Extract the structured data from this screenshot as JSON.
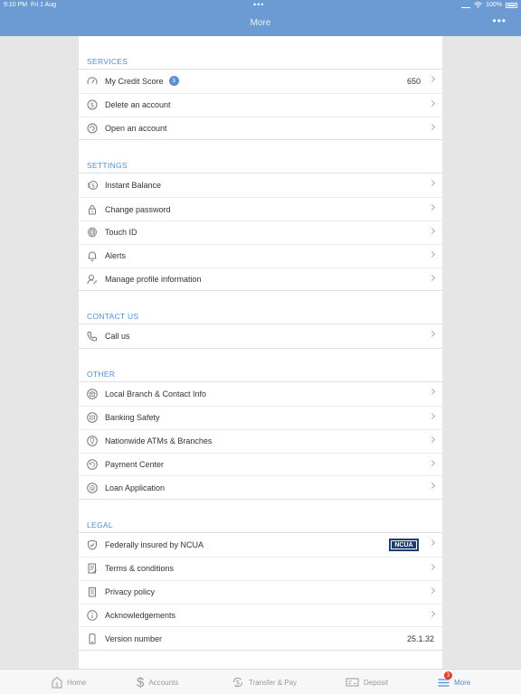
{
  "status_bar": {
    "time": "9:10 PM",
    "date": "Fri 1 Aug",
    "dots": "•••",
    "battery": "100%"
  },
  "nav": {
    "title": "More",
    "menu_icon": "•••"
  },
  "sections": {
    "services": {
      "header": "SERVICES",
      "items": [
        {
          "label": "My Credit Score",
          "badge": "3",
          "value": "650",
          "icon": "gauge-icon"
        },
        {
          "label": "Delete an account",
          "icon": "dollar-circle-icon"
        },
        {
          "label": "Open an account",
          "icon": "refresh-circle-icon"
        }
      ]
    },
    "settings": {
      "header": "SETTINGS",
      "items": [
        {
          "label": "Instant Balance",
          "icon": "coins-icon"
        },
        {
          "label": "Change password",
          "icon": "lock-icon"
        },
        {
          "label": "Touch ID",
          "icon": "fingerprint-icon"
        },
        {
          "label": "Alerts",
          "icon": "bell-icon"
        },
        {
          "label": "Manage profile information",
          "icon": "profile-edit-icon"
        }
      ]
    },
    "contact": {
      "header": "CONTACT US",
      "items": [
        {
          "label": "Call us",
          "icon": "phone-icon"
        }
      ]
    },
    "other": {
      "header": "OTHER",
      "items": [
        {
          "label": "Local Branch & Contact Info",
          "icon": "bank-icon"
        },
        {
          "label": "Banking Safety",
          "icon": "safety-icon"
        },
        {
          "label": "Nationwide ATMs & Branches",
          "icon": "location-icon"
        },
        {
          "label": "Payment Center",
          "icon": "payment-icon"
        },
        {
          "label": "Loan Application",
          "icon": "loan-icon"
        }
      ]
    },
    "legal": {
      "header": "LEGAL",
      "items": [
        {
          "label": "Federally insured by NCUA",
          "logo": "NCUA",
          "icon": "shield-check-icon"
        },
        {
          "label": "Terms & conditions",
          "icon": "document-icon"
        },
        {
          "label": "Privacy policy",
          "icon": "clipboard-icon"
        },
        {
          "label": "Acknowledgements",
          "icon": "info-icon"
        },
        {
          "label": "Version number",
          "value": "25.1.32",
          "icon": "phone-device-icon"
        }
      ]
    }
  },
  "tabbar": {
    "home": "Home",
    "accounts": "Accounts",
    "transfer": "Transfer & Pay",
    "deposit": "Deposit",
    "more": "More",
    "more_badge": "3"
  },
  "colors": {
    "accent": "#4f8fd0",
    "nav_bg": "#6b9bd2",
    "badge_red": "#e53b2f",
    "ncua_blue": "#1b3e6e"
  }
}
